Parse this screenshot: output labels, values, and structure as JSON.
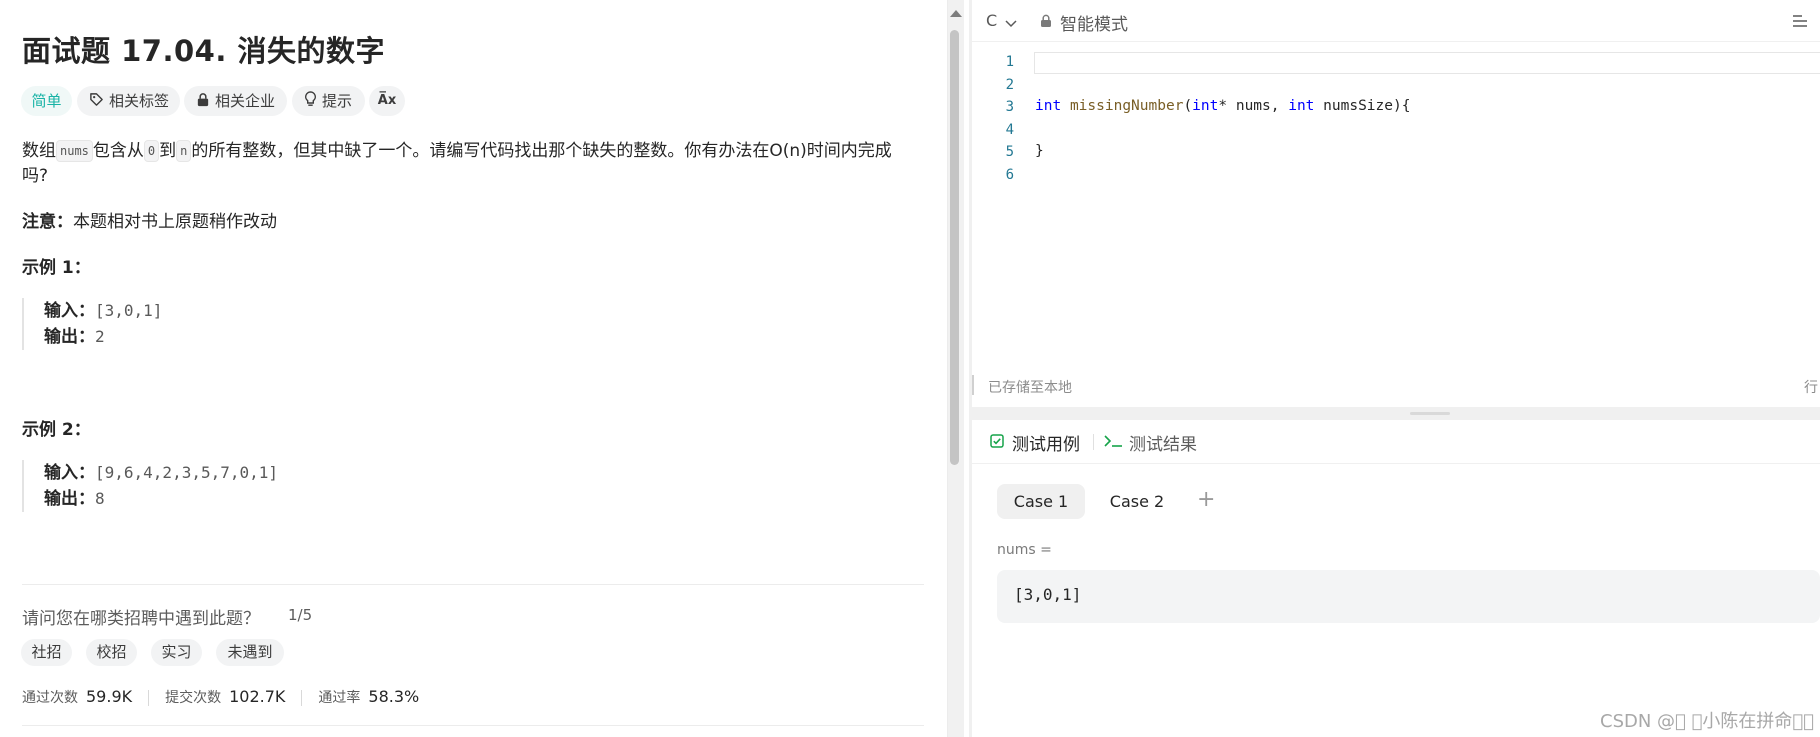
{
  "problem": {
    "title": "面试题 17.04. 消失的数字",
    "tags": {
      "difficulty": "简单",
      "related_tags": "相关标签",
      "related_company": "相关企业",
      "hint": "提示",
      "font": "A̅x"
    },
    "description": {
      "p1_a": "数组",
      "p1_code1": "nums",
      "p1_b": "包含从",
      "p1_code2": "0",
      "p1_c": "到",
      "p1_code3": "n",
      "p1_d": "的所有整数，但其中缺了一个。请编写代码找出那个缺失的整数。你有办法在O(n)时间内完成",
      "p1_e": "吗?",
      "note_label": "注意：",
      "note_text": "本题相对书上原题稍作改动"
    },
    "examples": [
      {
        "heading": "示例 1：",
        "input_label": "输入：",
        "input": "[3,0,1]",
        "output_label": "输出：",
        "output": "2"
      },
      {
        "heading": "示例 2：",
        "input_label": "输入：",
        "input": "[9,6,4,2,3,5,7,0,1]",
        "output_label": "输出：",
        "output": "8"
      }
    ],
    "survey": {
      "question": "请问您在哪类招聘中遇到此题？",
      "progress": "1/5",
      "options": [
        "社招",
        "校招",
        "实习",
        "未遇到"
      ]
    },
    "stats": {
      "accepted_label": "通过次数",
      "accepted": "59.9K",
      "submissions_label": "提交次数",
      "submissions": "102.7K",
      "rate_label": "通过率",
      "rate": "58.3%"
    }
  },
  "editor": {
    "language": "C",
    "mode": "智能模式",
    "line_numbers": [
      "1",
      "2",
      "3",
      "4",
      "5",
      "6"
    ],
    "code": {
      "kw1": "int",
      "fn": "missingNumber",
      "p1": "(",
      "kw2": "int",
      "p2": "* nums, ",
      "kw3": "int",
      "p3": " numsSize){",
      "close": "}"
    },
    "status": "已存储至本地",
    "cursor_label": "行"
  },
  "testcases": {
    "tab_cases": "测试用例",
    "tab_result": "测试结果",
    "cases": [
      "Case 1",
      "Case 2"
    ],
    "add": "+",
    "param_name": "nums =",
    "param_value": "[3,0,1]"
  },
  "watermark": "CSDN @\u0000 \u0000小陈在拼命\u0000\u0000"
}
